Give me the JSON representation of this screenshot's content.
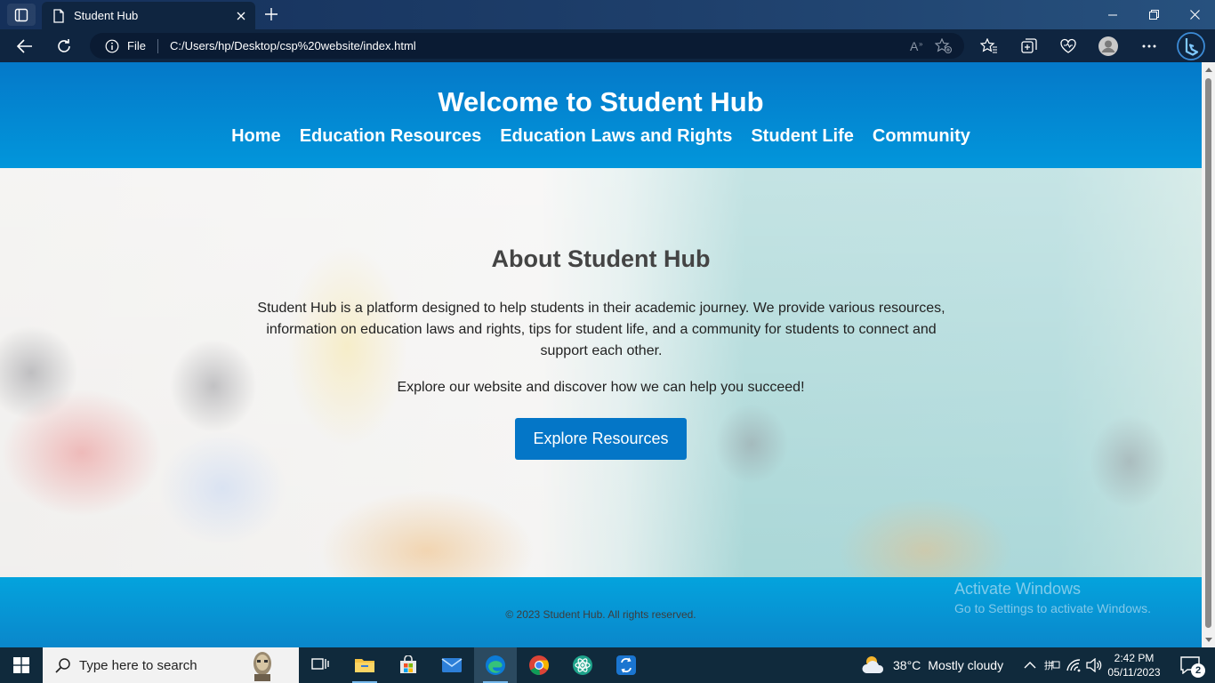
{
  "browser": {
    "tab_title": "Student Hub",
    "address_scheme": "File",
    "address_url": "C:/Users/hp/Desktop/csp%20website/index.html"
  },
  "site": {
    "title": "Welcome to Student Hub",
    "nav": [
      "Home",
      "Education Resources",
      "Education Laws and Rights",
      "Student Life",
      "Community"
    ],
    "hero": {
      "heading": "About Student Hub",
      "description": "Student Hub is a platform designed to help students in their academic journey. We provide various resources, information on education laws and rights, tips for student life, and a community for students to connect and support each other.",
      "explore_text": "Explore our website and discover how we can help you succeed!",
      "button_label": "Explore Resources"
    },
    "footer": {
      "copyright": "© 2023 Student Hub. All rights reserved."
    }
  },
  "watermark": {
    "line1": "Activate Windows",
    "line2": "Go to Settings to activate Windows."
  },
  "taskbar": {
    "search_placeholder": "Type here to search",
    "apps": [
      "task-view",
      "file-explorer",
      "microsoft-store",
      "mail",
      "edge",
      "chrome",
      "atom",
      "remote-desktop"
    ],
    "weather": {
      "temperature": "38°C",
      "condition": "Mostly cloudy"
    },
    "clock": {
      "time": "2:42 PM",
      "date": "05/11/2023"
    },
    "notification_count": "2"
  },
  "colors": {
    "header_blue": "#0479c9",
    "button_blue": "#0476c7",
    "footer_blue": "#04a3dd",
    "browser_dark": "#0f2540",
    "taskbar": "#102a3c"
  }
}
